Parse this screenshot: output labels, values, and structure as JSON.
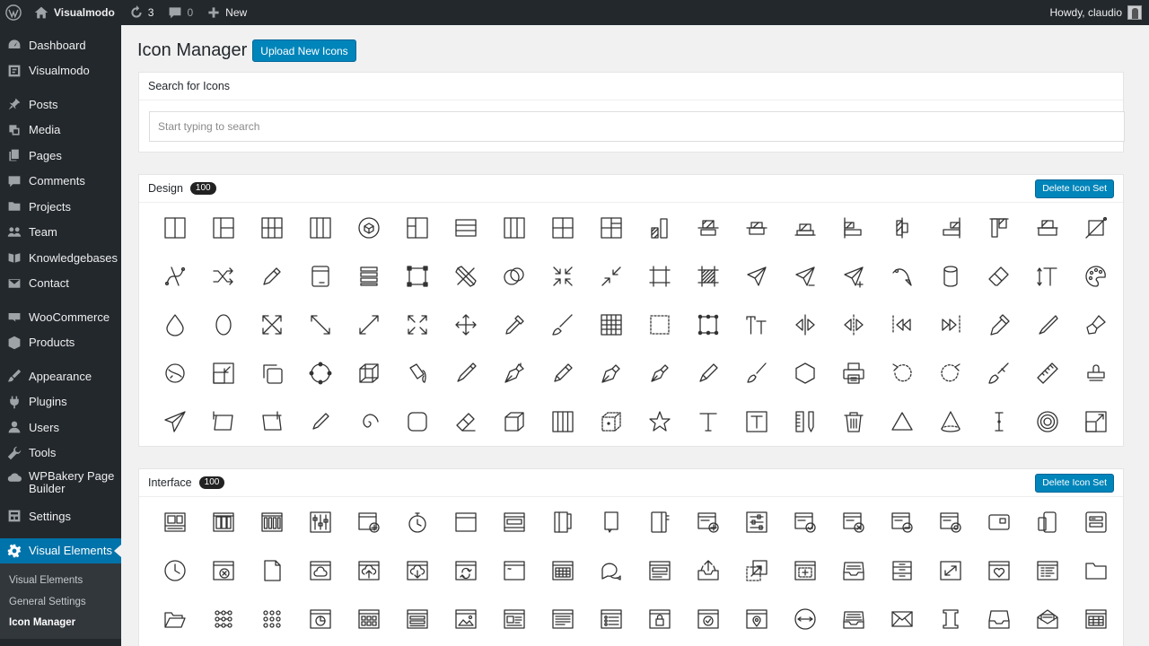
{
  "adminbar": {
    "site_name": "Visualmodo",
    "updates_count": "3",
    "comments_count": "0",
    "new_label": "New",
    "greeting": "Howdy, claudio"
  },
  "sidebar": {
    "items": [
      {
        "label": "Dashboard",
        "icon": "dashboard-icon"
      },
      {
        "label": "Visualmodo",
        "icon": "visualmodo-icon"
      },
      {
        "label": "Posts",
        "icon": "pin-icon"
      },
      {
        "label": "Media",
        "icon": "media-icon"
      },
      {
        "label": "Pages",
        "icon": "pages-icon"
      },
      {
        "label": "Comments",
        "icon": "comment-icon"
      },
      {
        "label": "Projects",
        "icon": "folder-icon"
      },
      {
        "label": "Team",
        "icon": "team-icon"
      },
      {
        "label": "Knowledgebases",
        "icon": "book-icon"
      },
      {
        "label": "Contact",
        "icon": "mail-icon"
      },
      {
        "label": "WooCommerce",
        "icon": "woo-icon"
      },
      {
        "label": "Products",
        "icon": "box-icon"
      },
      {
        "label": "Appearance",
        "icon": "brush-icon"
      },
      {
        "label": "Plugins",
        "icon": "plug-icon"
      },
      {
        "label": "Users",
        "icon": "user-icon"
      },
      {
        "label": "Tools",
        "icon": "wrench-icon"
      },
      {
        "label": "WPBakery Page Builder",
        "icon": "cloud-icon"
      },
      {
        "label": "Settings",
        "icon": "settings-icon"
      },
      {
        "label": "Visual Elements",
        "icon": "gear-icon"
      }
    ],
    "submenu": [
      "Visual Elements",
      "General Settings",
      "Icon Manager"
    ]
  },
  "page": {
    "title": "Icon Manager",
    "upload_button": "Upload New Icons"
  },
  "search": {
    "heading": "Search for Icons",
    "placeholder": "Start typing to search"
  },
  "icon_sets": [
    {
      "name": "Design",
      "count": "100",
      "delete_label": "Delete Icon Set"
    },
    {
      "name": "Interface",
      "count": "100",
      "delete_label": "Delete Icon Set"
    }
  ],
  "colors": {
    "admin_dark": "#23282d",
    "accent_blue": "#0073aa",
    "button_blue": "#0085ba"
  }
}
